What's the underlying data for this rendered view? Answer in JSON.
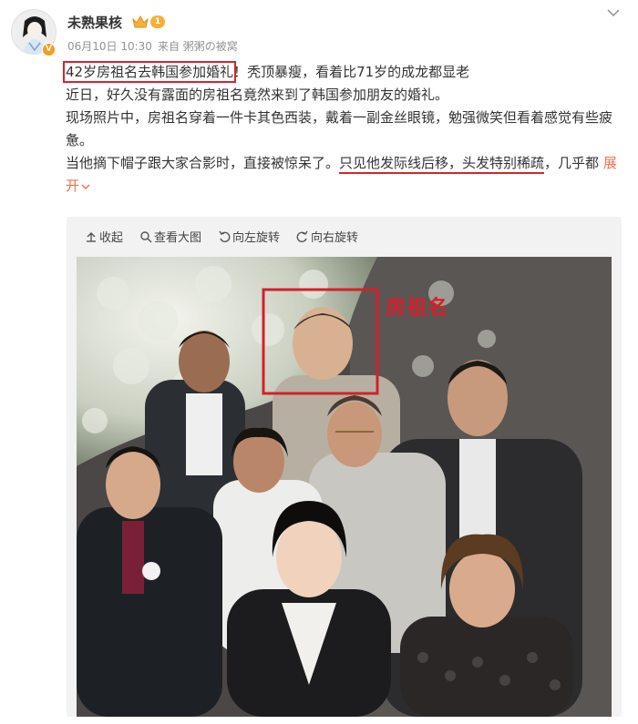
{
  "user": {
    "name": "未熟果核",
    "level": "1",
    "verified_badge": "V"
  },
  "meta": {
    "date": "06月10日 10:30",
    "source": "来自 粥粥の被窝"
  },
  "post": {
    "headline_box": "42岁房祖名去韩国参加婚礼",
    "headline_tail": "！秃顶暴瘦，看着比71岁的成龙都显老",
    "para1": "近日，好久没有露面的房祖名竟然来到了韩国参加朋友的婚礼。",
    "para2": "现场照片中，房祖名穿着一件卡其色西装，戴着一副金丝眼镜，勉强微笑但看着感觉有些疲惫。",
    "para3_start": "当他摘下帽子跟大家合影时，直接被惊呆了。",
    "para3_underline": "只见他发际线后移，头发特别稀疏",
    "para3_end": "，几乎都",
    "expand_label": "展开"
  },
  "toolbar": {
    "collapse": "收起",
    "view_large": "查看大图",
    "rotate_left": "向左旋转",
    "rotate_right": "向右旋转"
  },
  "photo": {
    "annotation_label": "房祖名"
  },
  "icons": {
    "more": "chevron-down-icon",
    "collapse": "arrow-up-icon",
    "view_large": "magnifier-icon",
    "rotate_left": "rotate-left-icon",
    "rotate_right": "rotate-right-icon",
    "level": "crown-icon"
  },
  "colors": {
    "accent_link": "#eb7350",
    "annotation_red": "#d61f2a",
    "meta_gray": "#939393"
  }
}
